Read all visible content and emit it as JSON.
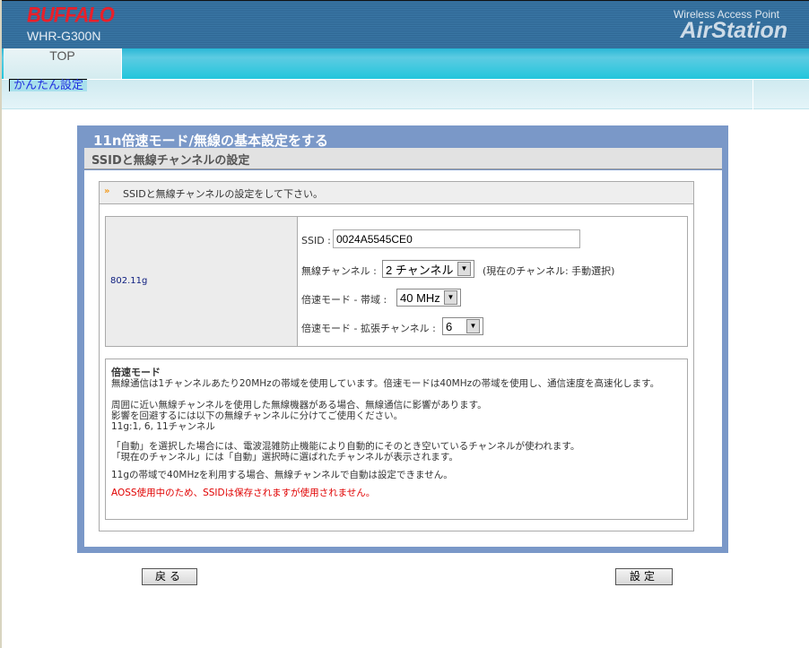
{
  "header": {
    "brand": "BUFFALO",
    "model": "WHR-G300N",
    "tagline": "Wireless Access Point",
    "product": "AirStation"
  },
  "nav": {
    "top_tab": "TOP",
    "sub_tab": "かんたん設定"
  },
  "panel": {
    "title": "11n倍速モード/無線の基本設定をする",
    "subtitle": "SSIDと無線チャンネルの設定",
    "instruction": "SSIDと無線チャンネルの設定をして下さい。"
  },
  "form": {
    "standard": "802.11g",
    "ssid_label": "SSID :",
    "ssid_value": "0024A5545CE0",
    "channel_label": "無線チャンネル :",
    "channel_value": "2 チャンネル",
    "channel_note": "(現在のチャンネル: 手動選択)",
    "bandwidth_label": "倍速モード - 帯域 :",
    "bandwidth_value": "40 MHz",
    "ext_label": "倍速モード - 拡張チャンネル :",
    "ext_value": "6"
  },
  "desc": {
    "heading": "倍速モード",
    "p1": "無線通信は1チャンネルあたり20MHzの帯域を使用しています。倍速モードは40MHzの帯域を使用し、通信速度を高速化します。",
    "p2a": "周囲に近い無線チャンネルを使用した無線機器がある場合、無線通信に影響があります。",
    "p2b": "影響を回避するには以下の無線チャンネルに分けてご使用ください。",
    "p2c": "11g:1, 6, 11チャンネル",
    "p3a": "「自動」を選択した場合には、電波混雑防止機能により自動的にそのとき空いているチャンネルが使われます。",
    "p3b": "「現在のチャンネル」には「自動」選択時に選ばれたチャンネルが表示されます。",
    "p4": "11gの帯域で40MHzを利用する場合、無線チャンネルで自動は設定できません。",
    "warning": "AOSS使用中のため、SSIDは保存されますが使用されません。"
  },
  "buttons": {
    "back": "戻る",
    "apply": "設定"
  }
}
